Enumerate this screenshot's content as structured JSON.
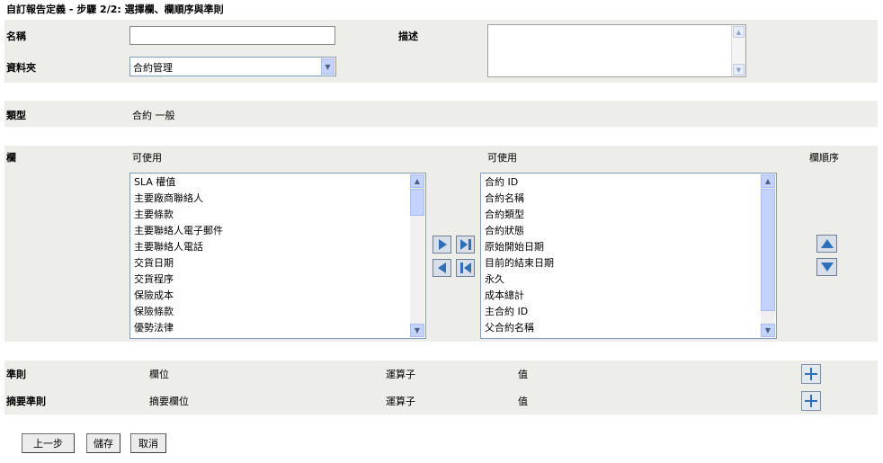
{
  "title": "自訂報告定義 - 步驟 2/2: 選擇欄、欄順序與準則",
  "form": {
    "name_label": "名稱",
    "name_value": "",
    "description_label": "描述",
    "folder_label": "資料夾",
    "folder_value": "合約管理",
    "type_label": "類型",
    "type_value": "合約 一般"
  },
  "columns": {
    "label": "欄",
    "available_header": "可使用",
    "selected_header": "可使用",
    "order_header": "欄順序",
    "available_items": [
      "SLA 權值",
      "主要廠商聯絡人",
      "主要條款",
      "主要聯絡人電子郵件",
      "主要聯絡人電話",
      "交貨日期",
      "交貨程序",
      "保險成本",
      "保險條款",
      "優勢法律"
    ],
    "selected_items": [
      "合約 ID",
      "合約名稱",
      "合約類型",
      "合約狀態",
      "原始開始日期",
      "目前的結束日期",
      "永久",
      "成本總計",
      "主合約 ID",
      "父合約名稱"
    ]
  },
  "criteria": {
    "criteria_label": "準則",
    "field_header": "欄位",
    "operator_header": "運算子",
    "value_header": "值",
    "summary_label": "摘要準則",
    "summary_field_header": "摘要欄位",
    "summary_operator_header": "運算子",
    "summary_value_header": "值"
  },
  "buttons": {
    "back": "上一步",
    "save": "儲存",
    "cancel": "取消"
  },
  "colors": {
    "band": "#ededea",
    "arrow_blue": "#2f6fb8"
  }
}
